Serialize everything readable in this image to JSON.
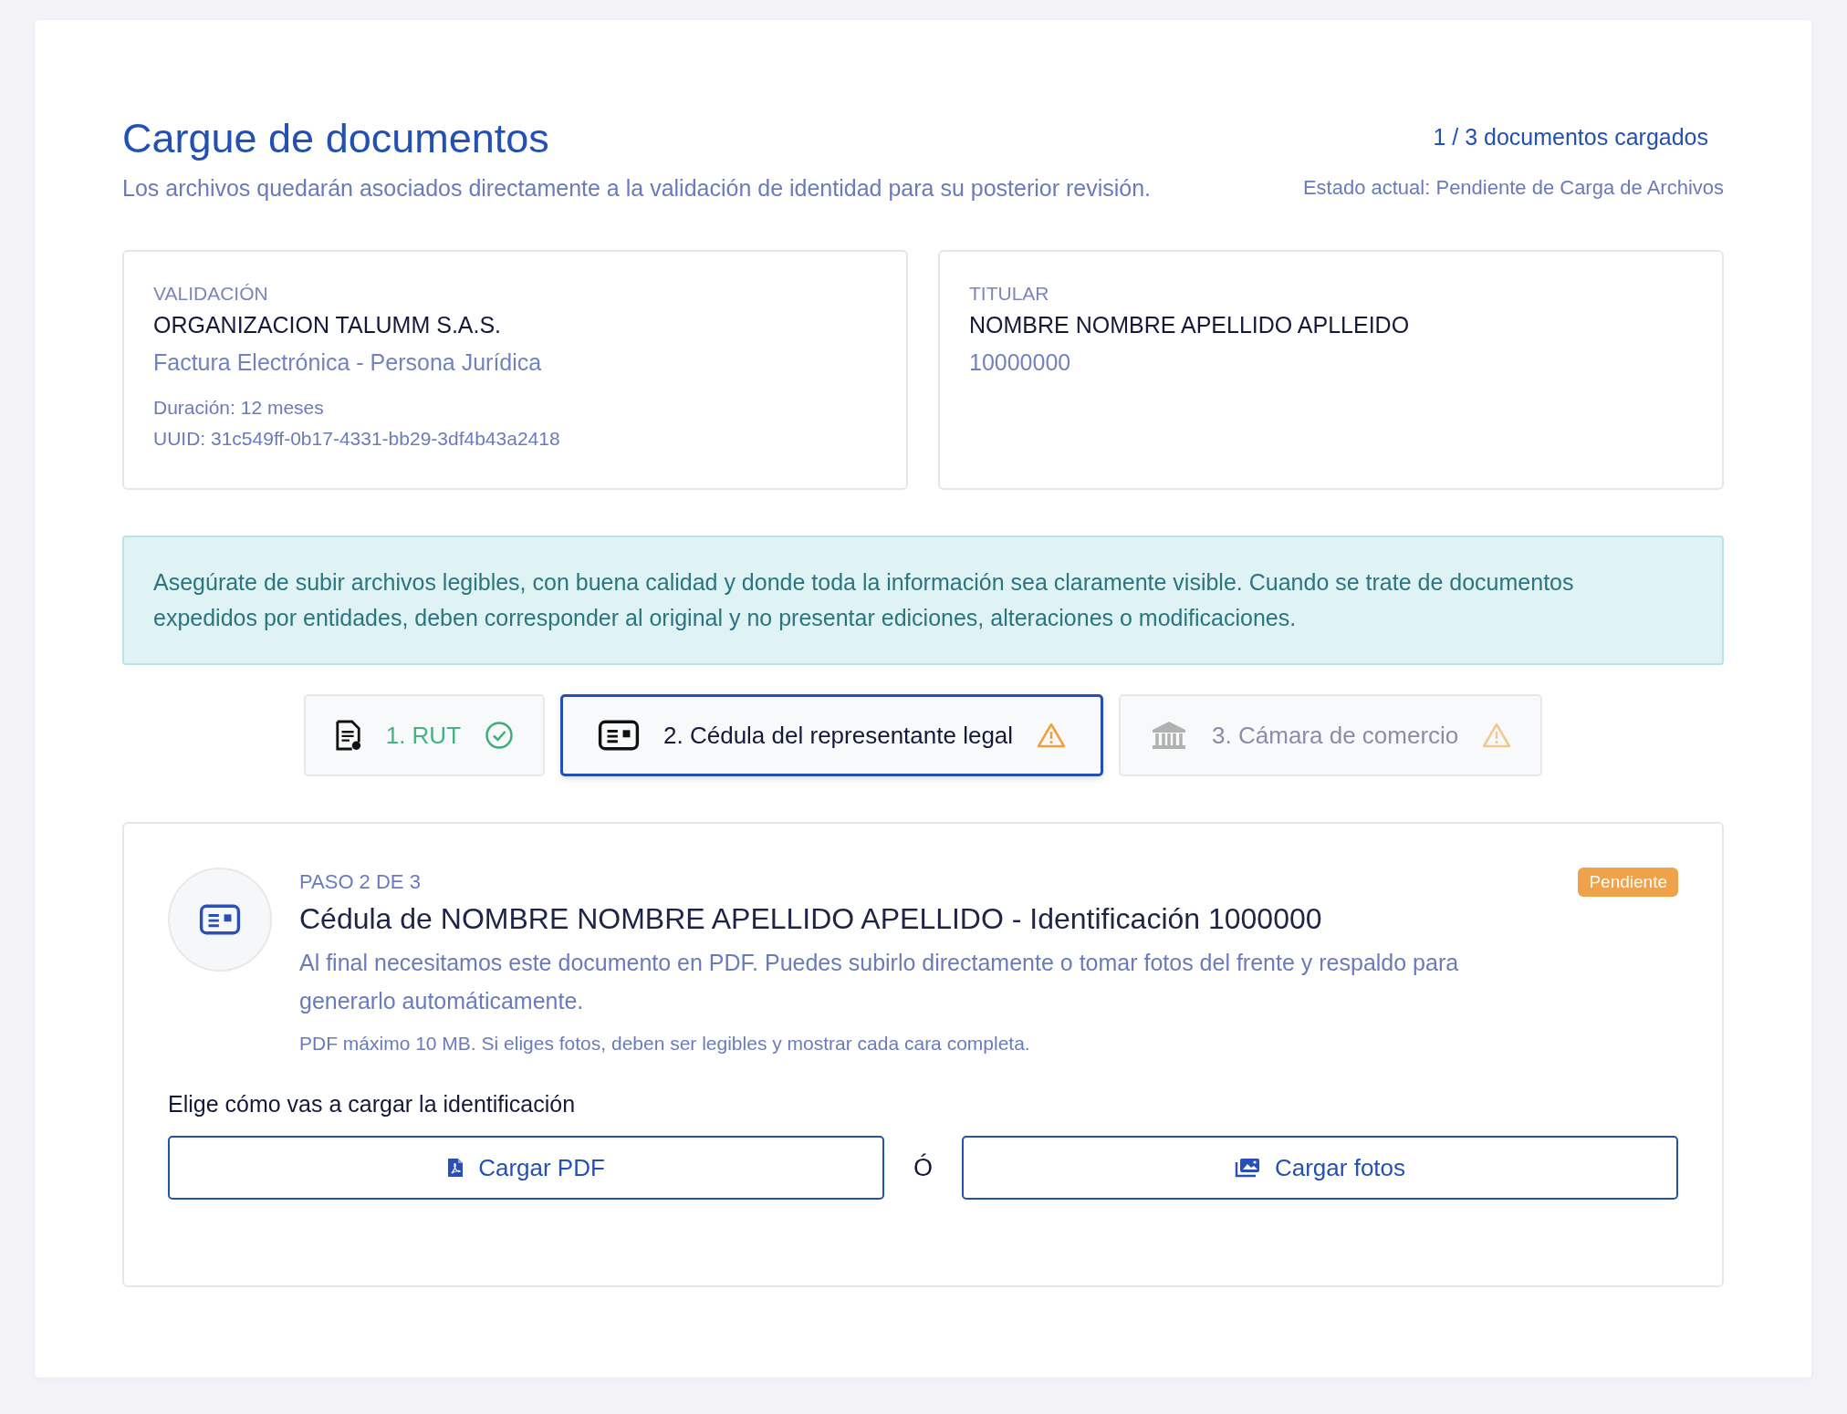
{
  "header": {
    "title": "Cargue de documentos",
    "subtitle": "Los archivos quedarán asociados directamente a la validación de identidad para su posterior revisión.",
    "progress": "1 / 3 documentos cargados",
    "status": "Estado actual: Pendiente de Carga de Archivos"
  },
  "info_cards": [
    {
      "label": "VALIDACIÓN",
      "name": "ORGANIZACION TALUMM S.A.S.",
      "detail": "Factura Electrónica - Persona Jurídica",
      "meta": [
        "Duración: 12 meses",
        "UUID: 31c549ff-0b17-4331-bb29-3df4b43a2418"
      ]
    },
    {
      "label": "TITULAR",
      "name": "NOMBRE NOMBRE APELLIDO APLLEIDO",
      "detail": "10000000"
    }
  ],
  "notice": "Asegúrate de subir archivos legibles, con buena calidad y donde toda la información sea claramente visible. Cuando se trate de documentos expedidos por entidades, deben corresponder al original y no presentar ediciones, alteraciones o modificaciones.",
  "tabs": [
    {
      "kind": "document",
      "label": "1. RUT",
      "done": true,
      "selected": false,
      "disabled": false
    },
    {
      "kind": "id-card",
      "label": "2. Cédula del representante legal",
      "done": false,
      "selected": true,
      "disabled": false
    },
    {
      "kind": "building",
      "label": "3. Cámara de comercio",
      "done": false,
      "selected": false,
      "disabled": true
    }
  ],
  "step": {
    "kind": "id-card",
    "step_label": "PASO 2 DE 3",
    "badge": "Pendiente",
    "title": "Cédula de NOMBRE NOMBRE APELLIDO APELLIDO - Identificación 1000000",
    "description": "Al final necesitamos este documento en PDF. Puedes subirlo directamente o tomar fotos del frente y respaldo para generarlo automáticamente.",
    "hint": "PDF máximo 10 MB. Si eliges fotos, deben ser legibles y mostrar cada cara completa.",
    "choice_label": "Elige cómo vas a cargar la identificación",
    "separator": "Ó",
    "buttons": [
      {
        "kind": "pdf",
        "label": "Cargar PDF"
      },
      {
        "kind": "photos",
        "label": "Cargar fotos"
      }
    ]
  }
}
